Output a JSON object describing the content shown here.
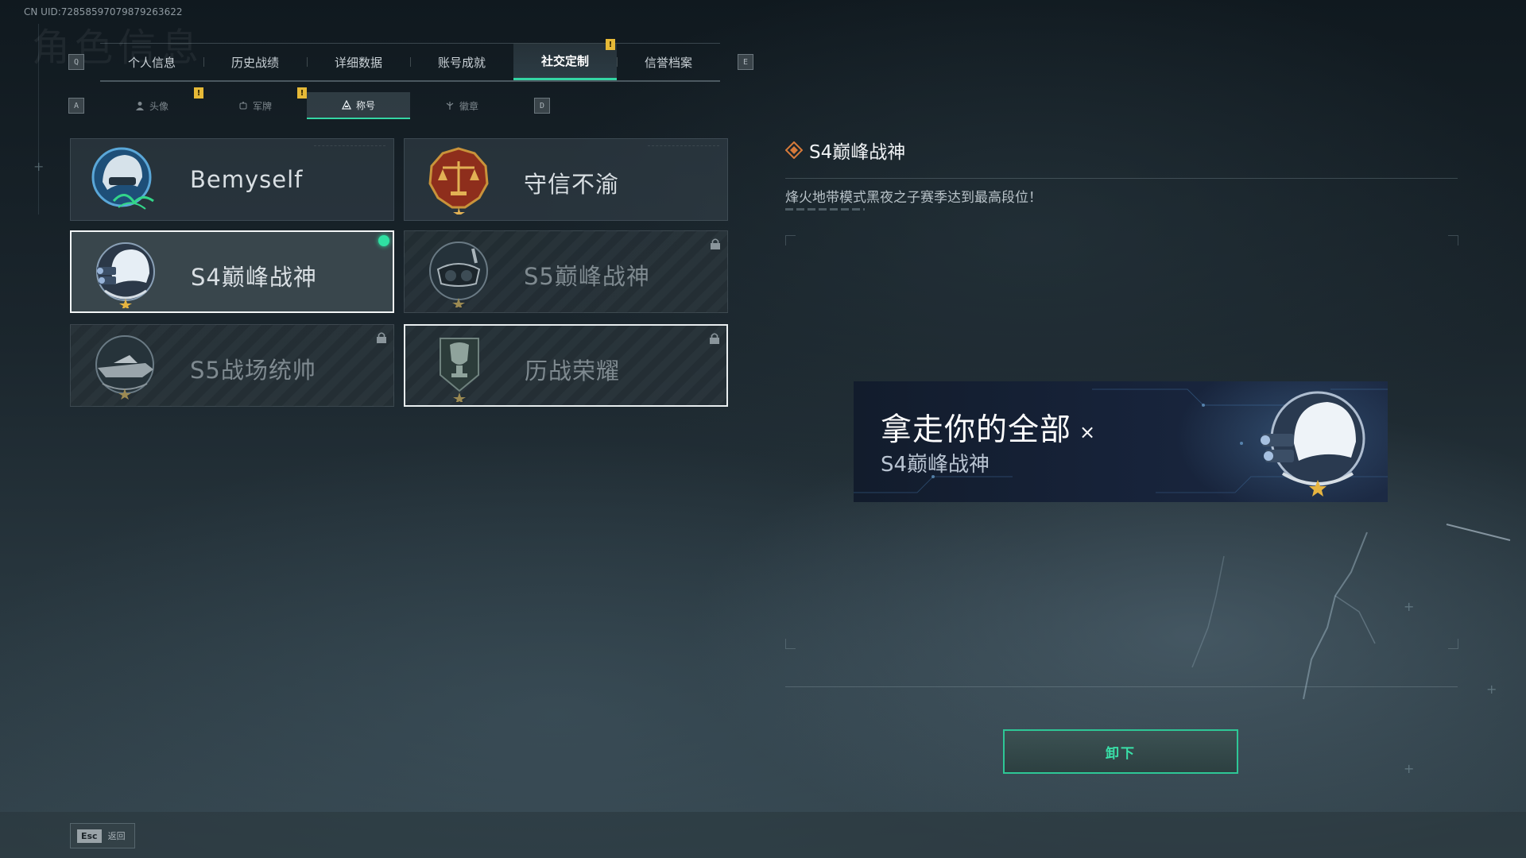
{
  "uid_text": "CN UID:72858597079879263622",
  "page_title_ghost": "角色信息",
  "tabs": {
    "left_key": "Q",
    "right_key": "E",
    "items": [
      {
        "label": "个人信息"
      },
      {
        "label": "历史战绩"
      },
      {
        "label": "详细数据"
      },
      {
        "label": "账号成就"
      },
      {
        "label": "社交定制",
        "active": true,
        "alert": "!"
      },
      {
        "label": "信誉档案"
      }
    ]
  },
  "subtabs": {
    "left_key": "A",
    "right_key": "D",
    "items": [
      {
        "label": "头像",
        "icon": "person-icon",
        "alert": "!"
      },
      {
        "label": "军牌",
        "icon": "dogtag-icon",
        "alert": "!"
      },
      {
        "label": "称号",
        "icon": "title-triangle-icon",
        "active": true
      },
      {
        "label": "徽章",
        "icon": "badge-icon"
      }
    ]
  },
  "titles": [
    {
      "name": "Bemyself",
      "badge": "helmet-signature-badge",
      "state": "unlocked"
    },
    {
      "name": "守信不渝",
      "badge": "scales-badge",
      "state": "unlocked"
    },
    {
      "name": "S4巅峰战神",
      "badge": "nightvision-helmet-badge",
      "state": "equipped"
    },
    {
      "name": "S5巅峰战神",
      "badge": "diving-mask-badge",
      "state": "locked"
    },
    {
      "name": "S5战场统帅",
      "badge": "boat-badge",
      "state": "locked"
    },
    {
      "name": "历战荣耀",
      "badge": "trophy-badge",
      "state": "locked"
    }
  ],
  "detail": {
    "title": "S4巅峰战神",
    "description": "烽火地带模式黑夜之子赛季达到最高段位！",
    "banner_main": "拿走你的全部",
    "banner_x": "×",
    "banner_sub": "S4巅峰战神",
    "action_button": "卸下"
  },
  "footer": {
    "esc_key": "Esc",
    "esc_label": "返回"
  },
  "colors": {
    "accent": "#34d6a4",
    "alert": "#e6b937",
    "equipped_dot": "#2fe0a2"
  }
}
